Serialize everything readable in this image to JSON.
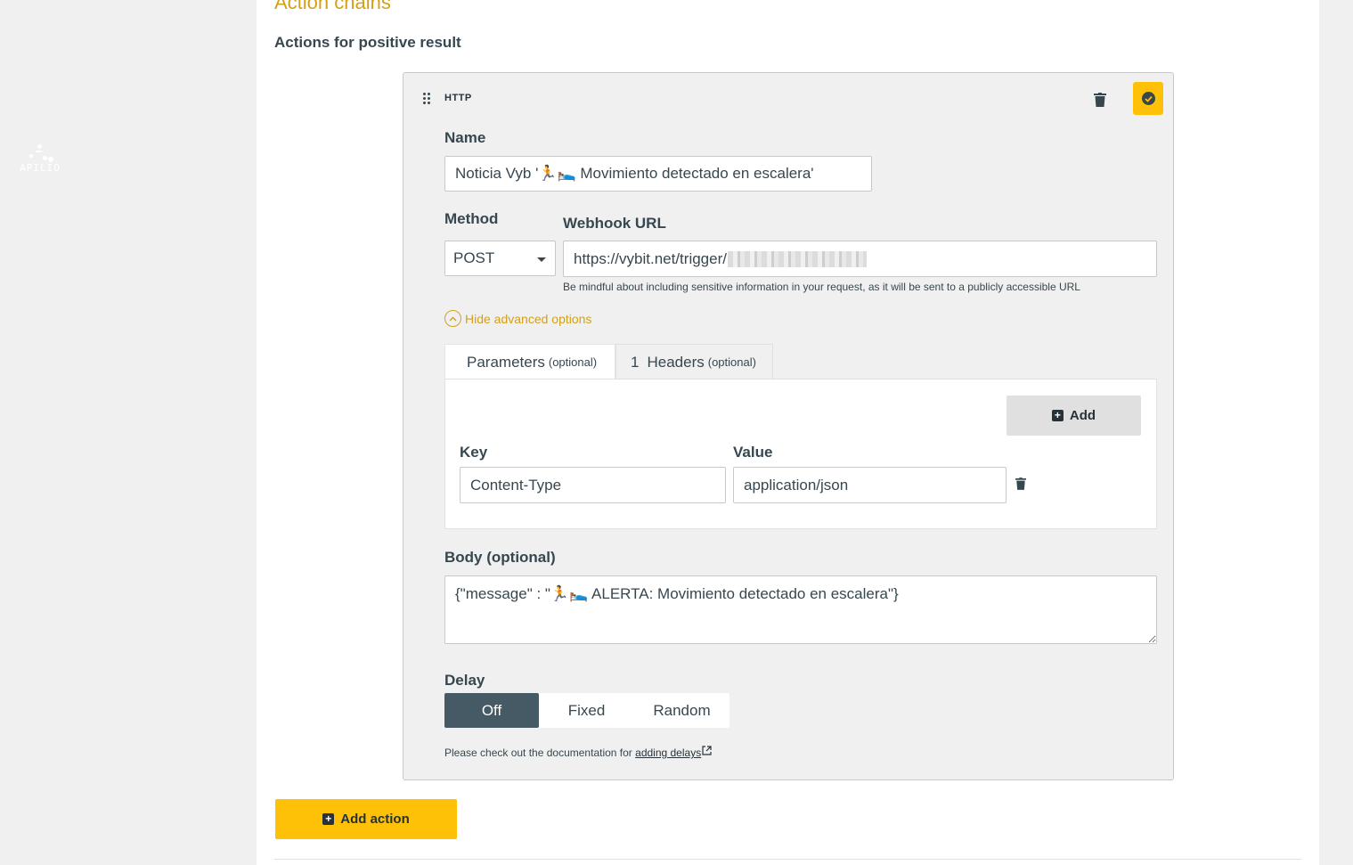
{
  "brand": {
    "logo_text": "APILIO"
  },
  "section": {
    "title": "Action chains",
    "subtitle": "Actions for positive result"
  },
  "action": {
    "type": "HTTP",
    "name_label": "Name",
    "name_value": "Noticia Vyb '🏃🛌 Movimiento detectado en escalera'",
    "method_label": "Method",
    "method_value": "POST",
    "url_label": "Webhook URL",
    "url_value": "https://vybit.net/trigger/",
    "url_hint": "Be mindful about including sensitive information in your request, as it will be sent to a publicly accessible URL",
    "advanced_toggle": "Hide advanced options",
    "tabs": {
      "parameters": {
        "label": "Parameters",
        "suffix": "(optional)"
      },
      "headers": {
        "count": "1",
        "label": "Headers",
        "suffix": "(optional)"
      }
    },
    "headers_panel": {
      "add_label": "Add",
      "key_label": "Key",
      "value_label": "Value",
      "rows": [
        {
          "key": "Content-Type",
          "value": "application/json"
        }
      ]
    },
    "body_label": "Body (optional)",
    "body_value": "{\"message\" : \"🏃🛌 ALERTA: Movimiento detectado en escalera\"}",
    "delay": {
      "label": "Delay",
      "options": [
        "Off",
        "Fixed",
        "Random"
      ],
      "selected": "Off",
      "doc_text": "Please check out the documentation for",
      "doc_link": "adding delays"
    }
  },
  "add_action_label": "Add action",
  "colors": {
    "accent": "#ffc107",
    "heading_accent": "#d4a017",
    "text": "#37474f",
    "segment_active": "#455a64"
  }
}
